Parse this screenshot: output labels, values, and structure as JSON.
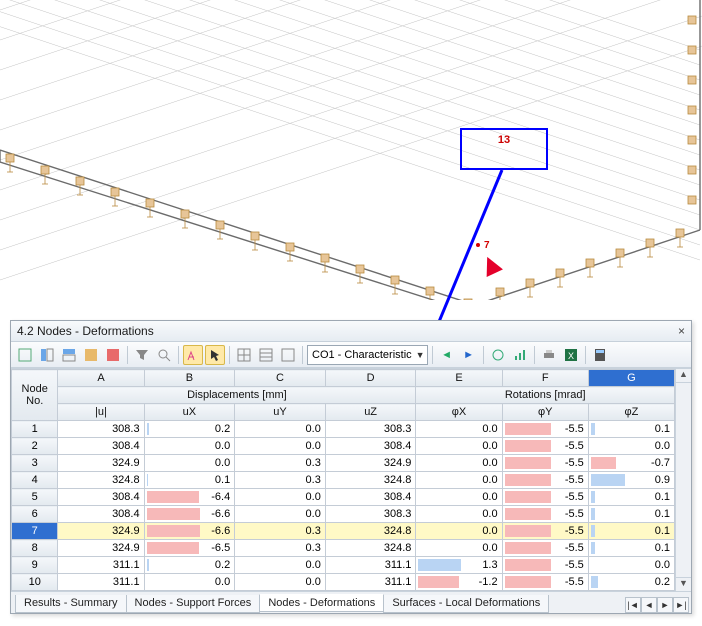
{
  "viewport": {
    "annotation_label": "13",
    "corner_label": "7"
  },
  "panel": {
    "title": "4.2 Nodes - Deformations",
    "combo_value": "CO1 - Characteristic",
    "columns_letters": [
      "A",
      "B",
      "C",
      "D",
      "E",
      "F",
      "G"
    ],
    "group_headers": {
      "node": "Node\nNo.",
      "displacements": "Displacements [mm]",
      "rotations": "Rotations [mrad]"
    },
    "sub_headers": [
      "|u|",
      "uX",
      "uY",
      "uZ",
      "φX",
      "φY",
      "φZ"
    ],
    "rows": [
      {
        "n": "1",
        "u": "308.3",
        "ux": "0.2",
        "uy": "0.0",
        "uz": "308.3",
        "px": "0.0",
        "py": "-5.5",
        "pz": "0.1",
        "uxbar": "pos:3",
        "pybar": "neg:55",
        "pzbar": "pos:5"
      },
      {
        "n": "2",
        "u": "308.4",
        "ux": "0.0",
        "uy": "0.0",
        "uz": "308.4",
        "px": "0.0",
        "py": "-5.5",
        "pz": "0.0",
        "uxbar": "pos:0",
        "pybar": "neg:55",
        "pzbar": "pos:0"
      },
      {
        "n": "3",
        "u": "324.9",
        "ux": "0.0",
        "uy": "0.3",
        "uz": "324.9",
        "px": "0.0",
        "py": "-5.5",
        "pz": "-0.7",
        "uxbar": "pos:0",
        "pybar": "neg:55",
        "pzbar": "neg:30"
      },
      {
        "n": "4",
        "u": "324.8",
        "ux": "0.1",
        "uy": "0.3",
        "uz": "324.8",
        "px": "0.0",
        "py": "-5.5",
        "pz": "0.9",
        "uxbar": "pos:2",
        "pybar": "neg:55",
        "pzbar": "pos:40"
      },
      {
        "n": "5",
        "u": "308.4",
        "ux": "-6.4",
        "uy": "0.0",
        "uz": "308.4",
        "px": "0.0",
        "py": "-5.5",
        "pz": "0.1",
        "uxbar": "neg:58",
        "pybar": "neg:55",
        "pzbar": "pos:5"
      },
      {
        "n": "6",
        "u": "308.4",
        "ux": "-6.6",
        "uy": "0.0",
        "uz": "308.3",
        "px": "0.0",
        "py": "-5.5",
        "pz": "0.1",
        "uxbar": "neg:60",
        "pybar": "neg:55",
        "pzbar": "pos:5"
      },
      {
        "n": "7",
        "u": "324.9",
        "ux": "-6.6",
        "uy": "0.3",
        "uz": "324.8",
        "px": "0.0",
        "py": "-5.5",
        "pz": "0.1",
        "uxbar": "neg:60",
        "pybar": "neg:55",
        "pzbar": "pos:5",
        "sel": true
      },
      {
        "n": "8",
        "u": "324.9",
        "ux": "-6.5",
        "uy": "0.3",
        "uz": "324.8",
        "px": "0.0",
        "py": "-5.5",
        "pz": "0.1",
        "uxbar": "neg:59",
        "pybar": "neg:55",
        "pzbar": "pos:5"
      },
      {
        "n": "9",
        "u": "311.1",
        "ux": "0.2",
        "uy": "0.0",
        "uz": "311.1",
        "px": "1.3",
        "py": "-5.5",
        "pz": "0.0",
        "uxbar": "pos:3",
        "pxbar": "pos:50",
        "pybar": "neg:55",
        "pzbar": "pos:0"
      },
      {
        "n": "10",
        "u": "311.1",
        "ux": "0.0",
        "uy": "0.0",
        "uz": "311.1",
        "px": "-1.2",
        "py": "-5.5",
        "pz": "0.2",
        "uxbar": "pos:0",
        "pxbar": "neg:48",
        "pybar": "neg:55",
        "pzbar": "pos:8"
      }
    ],
    "tabs": [
      "Results - Summary",
      "Nodes - Support Forces",
      "Nodes - Deformations",
      "Surfaces - Local Deformations"
    ],
    "active_tab": 2
  }
}
